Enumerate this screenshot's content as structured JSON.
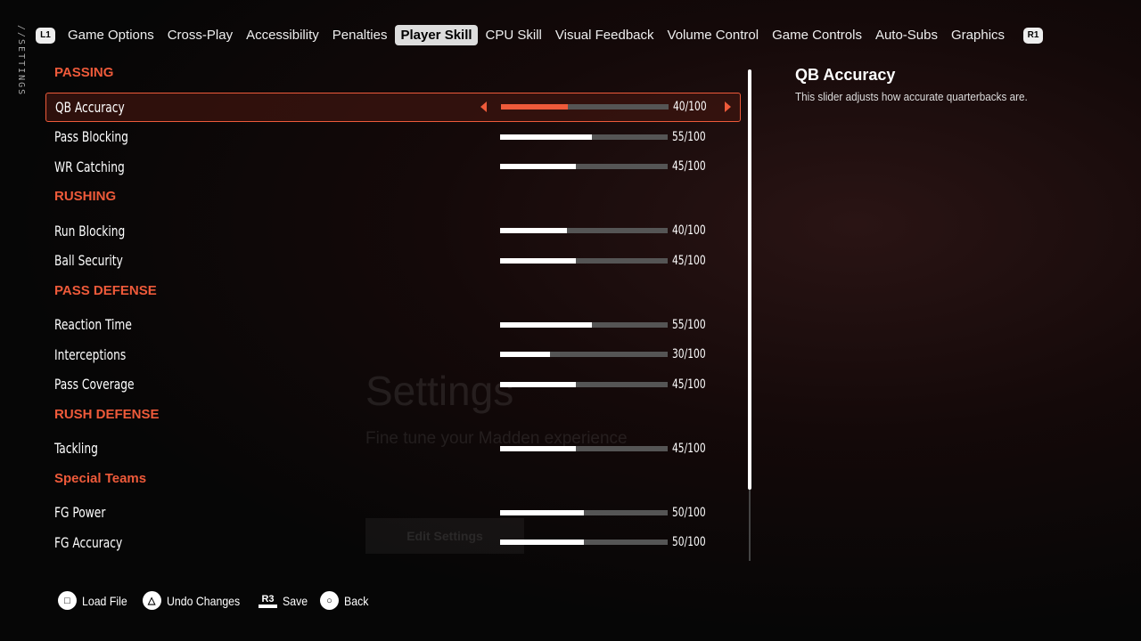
{
  "side_label": "//SETTINGS",
  "tabs": {
    "left_button": "L1",
    "right_button": "R1",
    "items": [
      "Game Options",
      "Cross-Play",
      "Accessibility",
      "Penalties",
      "Player Skill",
      "CPU Skill",
      "Visual Feedback",
      "Volume Control",
      "Game Controls",
      "Auto-Subs",
      "Graphics"
    ],
    "active": "Player Skill"
  },
  "background": {
    "title": "Settings",
    "subtitle": "Fine tune your Madden experience",
    "button": "Edit Settings"
  },
  "sections": [
    {
      "header": "PASSING",
      "rows": [
        {
          "label": "QB Accuracy",
          "value": 40,
          "text": "40/100",
          "selected": true
        },
        {
          "label": "Pass Blocking",
          "value": 55,
          "text": "55/100"
        },
        {
          "label": "WR Catching",
          "value": 45,
          "text": "45/100"
        }
      ]
    },
    {
      "header": "RUSHING",
      "rows": [
        {
          "label": "Run Blocking",
          "value": 40,
          "text": "40/100"
        },
        {
          "label": "Ball Security",
          "value": 45,
          "text": "45/100"
        }
      ]
    },
    {
      "header": "PASS DEFENSE",
      "rows": [
        {
          "label": "Reaction Time",
          "value": 55,
          "text": "55/100"
        },
        {
          "label": "Interceptions",
          "value": 30,
          "text": "30/100"
        },
        {
          "label": "Pass Coverage",
          "value": 45,
          "text": "45/100"
        }
      ]
    },
    {
      "header": "RUSH DEFENSE",
      "rows": [
        {
          "label": "Tackling",
          "value": 45,
          "text": "45/100"
        }
      ]
    },
    {
      "header": "Special Teams",
      "rows": [
        {
          "label": "FG Power",
          "value": 50,
          "text": "50/100"
        },
        {
          "label": "FG Accuracy",
          "value": 50,
          "text": "50/100"
        }
      ]
    }
  ],
  "description": {
    "title": "QB Accuracy",
    "text": "This slider adjusts how accurate quarterbacks are."
  },
  "footer": [
    {
      "icon": "square-button-icon",
      "glyph": "□",
      "label": "Load File"
    },
    {
      "icon": "triangle-button-icon",
      "glyph": "△",
      "label": "Undo Changes"
    },
    {
      "icon": "r3-button-icon",
      "glyph": "R3",
      "label": "Save"
    },
    {
      "icon": "circle-button-icon",
      "glyph": "○",
      "label": "Back"
    }
  ],
  "colors": {
    "accent": "#ee5a3a"
  }
}
